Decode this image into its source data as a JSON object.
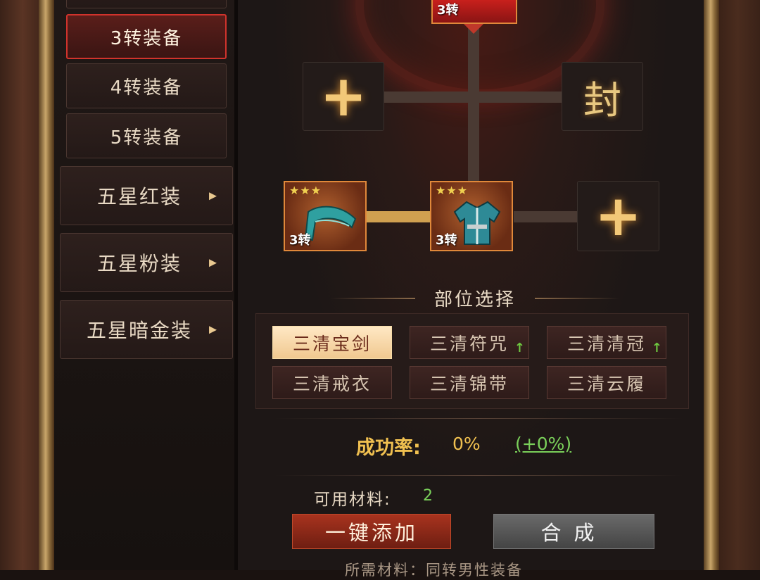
{
  "sidebar": {
    "tabs": [
      {
        "label": "3转装备",
        "active": true
      },
      {
        "label": "4转装备",
        "active": false
      },
      {
        "label": "5转装备",
        "active": false
      }
    ],
    "categories": [
      {
        "label": "五星红装",
        "arrow": "▸"
      },
      {
        "label": "五星粉装",
        "arrow": "▸"
      },
      {
        "label": "五星暗金装",
        "arrow": "▸"
      }
    ]
  },
  "tree": {
    "top_item": {
      "tier": "3转"
    },
    "left_slot": {
      "icon": "plus-icon",
      "glyph": "+"
    },
    "right_slot": {
      "icon": "seal-icon",
      "glyph": "封"
    },
    "material_1": {
      "stars": "★★★",
      "tier": "3转",
      "icon": "sash-icon"
    },
    "material_2": {
      "stars": "★★★",
      "tier": "3转",
      "icon": "robe-icon"
    },
    "add_slot": {
      "icon": "plus-icon",
      "glyph": "+"
    }
  },
  "parts": {
    "title": "部位选择",
    "items": [
      {
        "label": "三清宝剑",
        "selected": true,
        "upgrade": false
      },
      {
        "label": "三清符咒",
        "selected": false,
        "upgrade": true
      },
      {
        "label": "三清清冠",
        "selected": false,
        "upgrade": true
      },
      {
        "label": "三清戒衣",
        "selected": false,
        "upgrade": false
      },
      {
        "label": "三清锦带",
        "selected": false,
        "upgrade": false
      },
      {
        "label": "三清云履",
        "selected": false,
        "upgrade": false
      }
    ]
  },
  "rate": {
    "label": "成功率:",
    "value": "0%",
    "bonus": "(+0%)"
  },
  "materials": {
    "label": "可用材料:",
    "count": "2"
  },
  "buttons": {
    "add": "一键添加",
    "craft": "合成"
  },
  "footer": {
    "text": "所需材料：同转男性装备"
  },
  "colors": {
    "accent_gold": "#f0c050",
    "active_red": "#d0332c",
    "bonus_green": "#7ad05a"
  }
}
